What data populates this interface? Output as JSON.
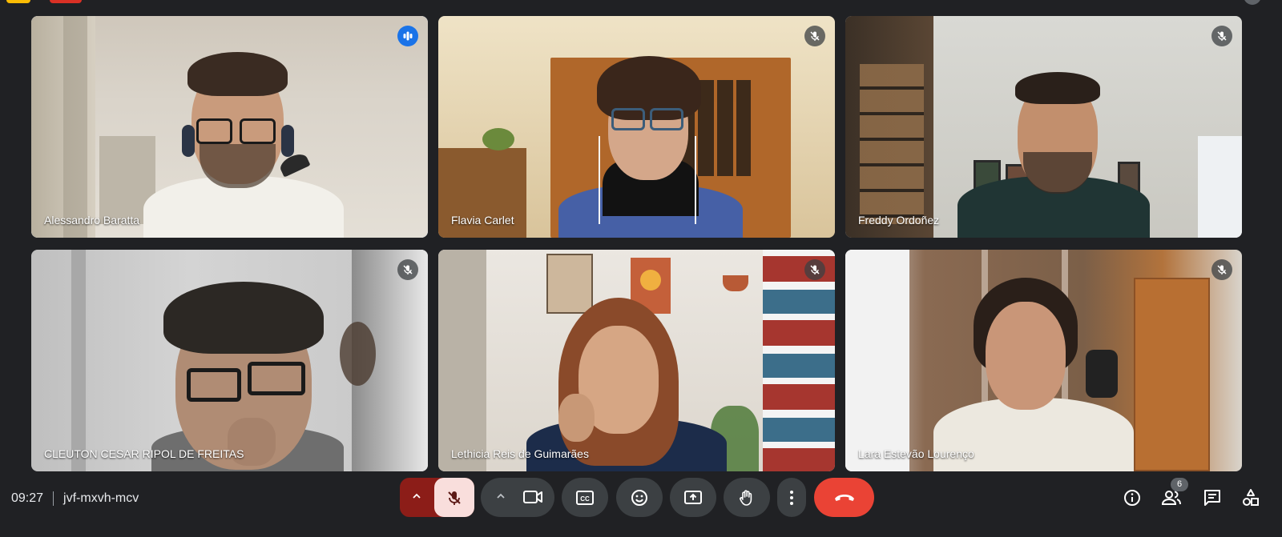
{
  "meeting": {
    "time": "09:27",
    "code": "jvf-mxvh-mcv",
    "participants_count": "6"
  },
  "tiles": [
    {
      "name": "Alessandro Baratta",
      "status": "speaking",
      "icon": "audio-bars-icon"
    },
    {
      "name": "Flavia Carlet",
      "status": "muted",
      "icon": "mic-off-icon"
    },
    {
      "name": "Freddy Ordoñez",
      "status": "muted",
      "icon": "mic-off-icon"
    },
    {
      "name": "CLEUTON CESAR RIPOL DE FREITAS",
      "status": "muted",
      "icon": "mic-off-icon"
    },
    {
      "name": "Lethicia Reis de Guimarães",
      "status": "muted",
      "icon": "mic-off-icon"
    },
    {
      "name": "Lara Estevão Lourenço",
      "status": "muted",
      "icon": "mic-off-icon"
    }
  ],
  "controls": {
    "mic": {
      "icon": "mic-off-icon",
      "state": "muted"
    },
    "camera": {
      "icon": "videocam-icon"
    },
    "captions": {
      "icon": "closed-captions-icon"
    },
    "reactions": {
      "icon": "emoji-icon"
    },
    "present": {
      "icon": "present-screen-icon"
    },
    "raise_hand": {
      "icon": "hand-icon"
    },
    "more": {
      "icon": "more-vert-icon"
    },
    "leave": {
      "icon": "call-end-icon"
    }
  },
  "side_controls": [
    "info-icon",
    "people-icon",
    "chat-icon",
    "activities-icon"
  ],
  "colors": {
    "background": "#202124",
    "control": "#3c4043",
    "leave": "#ea4335",
    "mic_muted": "#f9dedc",
    "speaking_outline": "#8ab4f8"
  }
}
